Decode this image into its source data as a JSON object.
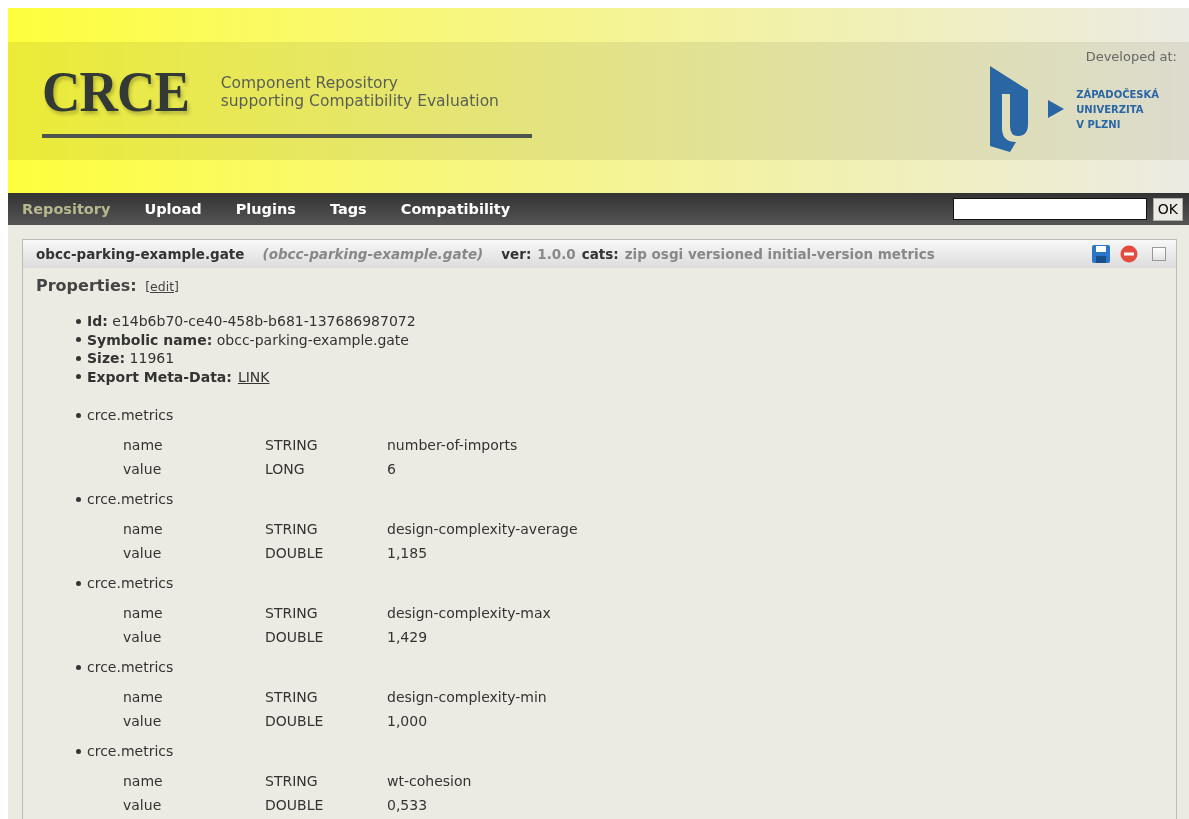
{
  "header": {
    "logo": "CRCE",
    "subtitle_lines": [
      "Component Repository",
      "supporting Compatibility Evaluation"
    ],
    "developed_at": "Developed at:",
    "university_lines": [
      "ZÁPADOČESKÁ",
      "UNIVERZITA",
      "V PLZNI"
    ]
  },
  "nav": {
    "items": [
      {
        "label": "Repository",
        "selected": true
      },
      {
        "label": "Upload",
        "selected": false
      },
      {
        "label": "Plugins",
        "selected": false
      },
      {
        "label": "Tags",
        "selected": false
      },
      {
        "label": "Compatibility",
        "selected": false
      }
    ],
    "search_button": "OK"
  },
  "component": {
    "name": "obcc-parking-example.gate",
    "symbolic": "(obcc-parking-example.gate)",
    "ver_label": "ver:",
    "version": "1.0.0",
    "cats_label": "cats:",
    "categories": "zip osgi versioned initial-version metrics",
    "checked": false,
    "properties_label": "Properties:",
    "edit_link": "[edit]",
    "properties": [
      {
        "label": "Id:",
        "value": "e14b6b70-ce40-458b-b681-137686987072"
      },
      {
        "label": "Symbolic name:",
        "value": "obcc-parking-example.gate"
      },
      {
        "label": "Size:",
        "value": "11961"
      },
      {
        "label": "Export Meta-Data:",
        "link": "LINK"
      }
    ],
    "capabilities": [
      {
        "namespace": "crce.metrics",
        "attributes": [
          {
            "name": "name",
            "type": "STRING",
            "value": "number-of-imports"
          },
          {
            "name": "value",
            "type": "LONG",
            "value": "6"
          }
        ]
      },
      {
        "namespace": "crce.metrics",
        "attributes": [
          {
            "name": "name",
            "type": "STRING",
            "value": "design-complexity-average"
          },
          {
            "name": "value",
            "type": "DOUBLE",
            "value": "1,185"
          }
        ]
      },
      {
        "namespace": "crce.metrics",
        "attributes": [
          {
            "name": "name",
            "type": "STRING",
            "value": "design-complexity-max"
          },
          {
            "name": "value",
            "type": "DOUBLE",
            "value": "1,429"
          }
        ]
      },
      {
        "namespace": "crce.metrics",
        "attributes": [
          {
            "name": "name",
            "type": "STRING",
            "value": "design-complexity-min"
          },
          {
            "name": "value",
            "type": "DOUBLE",
            "value": "1,000"
          }
        ]
      },
      {
        "namespace": "crce.metrics",
        "attributes": [
          {
            "name": "name",
            "type": "STRING",
            "value": "wt-cohesion"
          },
          {
            "name": "value",
            "type": "DOUBLE",
            "value": "0,533"
          }
        ]
      }
    ]
  }
}
